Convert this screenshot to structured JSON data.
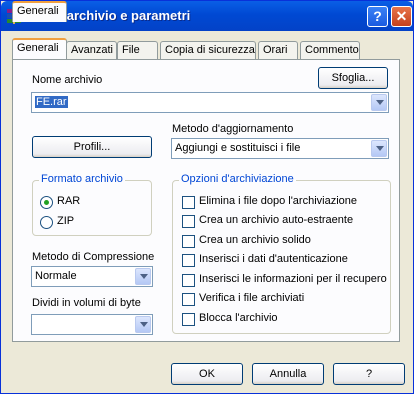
{
  "window": {
    "title": "Nome archivio e parametri",
    "help_glyph": "?",
    "close_glyph": "✕"
  },
  "tabs": [
    "Generali",
    "Avanzati",
    "File",
    "Copia di sicurezza",
    "Orari",
    "Commento"
  ],
  "archive_name": {
    "label": "Nome archivio",
    "value": "FE.rar",
    "browse_label": "Sfoglia..."
  },
  "profiles_label": "Profili...",
  "update_method": {
    "label": "Metodo d'aggiornamento",
    "value": "Aggiungi e sostituisci i file"
  },
  "archive_format": {
    "label": "Formato archivio",
    "options": [
      "RAR",
      "ZIP"
    ],
    "selected": "RAR"
  },
  "compression": {
    "label": "Metodo di Compressione",
    "value": "Normale"
  },
  "split": {
    "label": "Dividi in volumi di byte",
    "value": ""
  },
  "archive_options": {
    "label": "Opzioni d'archiviazione",
    "items": [
      "Elimina i file dopo l'archiviazione",
      "Crea un archivio auto-estraente",
      "Crea un archivio solido",
      "Inserisci i dati d'autenticazione",
      "Inserisci le informazioni per il recupero",
      "Verifica i file archiviati",
      "Blocca l'archivio"
    ]
  },
  "buttons": {
    "ok": "OK",
    "cancel": "Annulla",
    "help": "?"
  }
}
